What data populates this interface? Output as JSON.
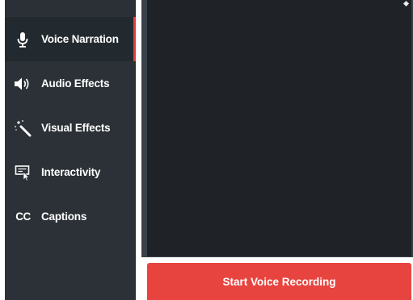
{
  "sidebar": {
    "items": [
      {
        "label": "Voice Narration",
        "icon": "microphone-icon",
        "active": true
      },
      {
        "label": "Audio Effects",
        "icon": "speaker-icon",
        "active": false
      },
      {
        "label": "Visual Effects",
        "icon": "magic-wand-icon",
        "active": false
      },
      {
        "label": "Interactivity",
        "icon": "interactive-screen-icon",
        "active": false
      },
      {
        "label": "Captions",
        "icon": "closed-captions-icon",
        "icon_text": "CC",
        "active": false
      }
    ]
  },
  "main": {
    "record_button_label": "Start Voice Recording"
  },
  "colors": {
    "sidebar_bg": "#2b3137",
    "active_item_bg": "#232a2f",
    "accent_red": "#e8443f",
    "preview_bg": "#1f2327"
  }
}
